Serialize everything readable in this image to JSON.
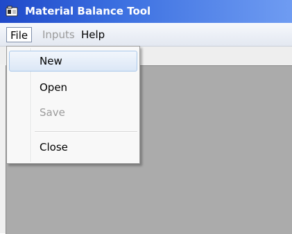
{
  "window": {
    "title": "Material Balance Tool",
    "icon": "app-icon"
  },
  "menubar": {
    "file": "File",
    "inputs": "Inputs",
    "help": "Help"
  },
  "file_menu": {
    "new": "New",
    "open": "Open",
    "save": "Save",
    "close": "Close"
  },
  "colors": {
    "titlebar": "#1f49c9",
    "content": "#ababab",
    "highlight": "#dbe7f6",
    "disabled_text": "#9a9a9a"
  }
}
